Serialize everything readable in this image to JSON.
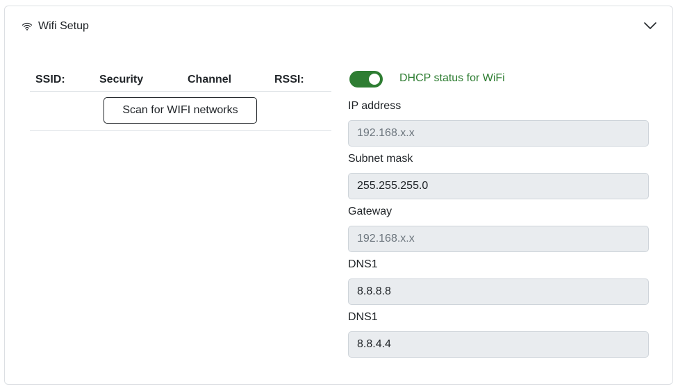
{
  "header": {
    "title": "Wifi Setup",
    "icon": "wifi-icon",
    "toggle_icon": "chevron-down-icon"
  },
  "scan_table": {
    "columns": [
      "SSID:",
      "Security",
      "Channel",
      "RSSI:"
    ],
    "scan_button_label": "Scan for WIFI networks"
  },
  "form": {
    "dhcp": {
      "label": "DHCP status for WiFi",
      "enabled": true,
      "accent_color": "#2e7d32"
    },
    "fields": [
      {
        "label": "IP address",
        "value": "",
        "placeholder": "192.168.x.x"
      },
      {
        "label": "Subnet mask",
        "value": "255.255.255.0",
        "placeholder": ""
      },
      {
        "label": "Gateway",
        "value": "",
        "placeholder": "192.168.x.x"
      },
      {
        "label": "DNS1",
        "value": "8.8.8.8",
        "placeholder": ""
      },
      {
        "label": "DNS1",
        "value": "8.8.4.4",
        "placeholder": ""
      }
    ]
  }
}
